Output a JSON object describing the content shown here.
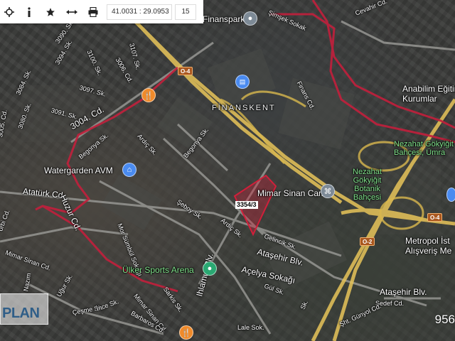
{
  "toolbar": {
    "coordinates": "41.0031 : 29.0953",
    "zoom": "15",
    "icons": [
      "crosshair-icon",
      "info-icon",
      "star-icon",
      "measure-icon",
      "print-icon"
    ]
  },
  "parcel": {
    "label": "3354/3",
    "color": "#d11f3a"
  },
  "districts": {
    "finanskent": "FİNANSKENT"
  },
  "pois": {
    "finanspark": "Finanspark",
    "watergarden": "Watergarden AVM",
    "mimar_sinan": "Mimar Sinan Camii",
    "ulker": "Ülker Sports Arena",
    "metropol": "Metropol İst\nAlışveriş Me",
    "anabilim": "Anabilim Eğitim\nKurumlar",
    "nezahat_garden": "Nezahat Gökyiğit\nBahçesi, Ümra",
    "nezahat_green": "Nezahat\nGökyiğit\nBotanik\nBahçesi"
  },
  "streets": {
    "simsek": "Şimşek Sokak",
    "cevahir": "Cevahir Cd.",
    "finans_cd": "Finans Cd.",
    "s3090": "3090. Sk.",
    "s3094": "3094. Sk.",
    "s3100": "3100. Sk.",
    "s3006": "3006. Cd.",
    "s3107": "3107. Sk.",
    "s3097": "3097. Sk.",
    "s3084": "3084. Sk.",
    "s3080": "3080. Sk.",
    "s3091": "3091. Sk.",
    "s3005": "3005. Cd.",
    "s3004": "3004. Cd.",
    "begonya1": "Begonya Sk.",
    "begonya2": "Begonya Sk.",
    "ardic1": "Ardıç Sk.",
    "ardic2": "Ardıç Sk.",
    "ataturk": "Atatürk Cd.",
    "huzur": "Huzur Cd.",
    "mor_sumbul": "Mor Sümbül Sokağı",
    "seboy": "Şeboy Sk.",
    "gelincik": "Gelincik Sk.",
    "atasehir_blv1": "Ataşehir Blv.",
    "atasehir_blv2": "Ataşehir Blv.",
    "acelya": "Açelya Sokağı",
    "gul": "Gül Sk.",
    "ihlamur": "Ihlamur Blv.",
    "lale": "Lale Sok.",
    "sarkis": "Sarkis Sk.",
    "mimar_sinan_cd1": "Mimar Sinan Cd.",
    "mimar_sinan_cd2": "Mimar Sinan Cd.",
    "ugur": "Uğur Sk.",
    "cesme": "Çeşme Sk.",
    "barbaros": "Barbaros Cd.",
    "sedef": "Sedef Cd.",
    "gunyol": "Şht. Günyol Cd.",
    "orbi": "orbi Cd.",
    "nazim": "Nazım",
    "ince": "İnce Sk.",
    "kardelen": "Sk."
  },
  "shields": {
    "o4a": "O-4",
    "o4b": "O-4",
    "o2": "O-2"
  },
  "watermark": "PLAN",
  "scale_text": "956",
  "colors": {
    "highway": "#e8c55a",
    "boundary": "#c2203c",
    "parcel": "#d11f3a"
  }
}
